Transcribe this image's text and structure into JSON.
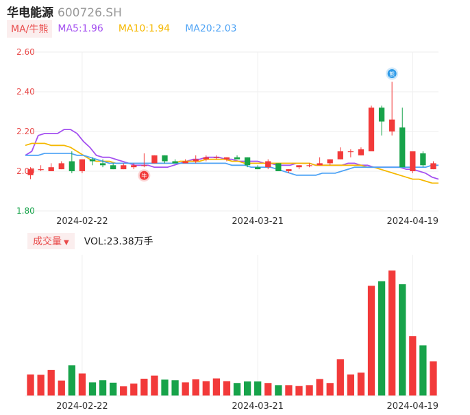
{
  "header": {
    "name": "华电能源",
    "code": "600726.SH"
  },
  "legend": {
    "tag": "MA/牛熊",
    "items": [
      {
        "label": "MA5:1.96",
        "color": "#a450f0"
      },
      {
        "label": "MA10:1.94",
        "color": "#f5b800"
      },
      {
        "label": "MA20:2.03",
        "color": "#4ea3f5"
      }
    ]
  },
  "volume_legend": {
    "tag": "成交量",
    "caret": "▼",
    "value": "VOL:23.38万手"
  },
  "markers": {
    "bull_glyph": "牛",
    "bear_glyph": "熊"
  },
  "colors": {
    "up": "#f23a3a",
    "down": "#17a34a",
    "axis_label": "#e94b4b",
    "grid": "#eeeeee"
  },
  "chart_data": [
    {
      "type": "candlestick",
      "y_ticks": [
        "2.60",
        "2.40",
        "2.20",
        "2.00",
        "1.80"
      ],
      "ylim": [
        1.8,
        2.6
      ],
      "x_labels": [
        {
          "index": 5,
          "label": "2024-02-22"
        },
        {
          "index": 22,
          "label": "2024-03-21"
        },
        {
          "index": 37,
          "label": "2024-04-19"
        }
      ],
      "candles": [
        {
          "o": 1.98,
          "h": 2.02,
          "l": 1.96,
          "c": 2.01
        },
        {
          "o": 2.01,
          "h": 2.03,
          "l": 2.0,
          "c": 2.01
        },
        {
          "o": 2.0,
          "h": 2.04,
          "l": 2.0,
          "c": 2.02
        },
        {
          "o": 2.01,
          "h": 2.05,
          "l": 2.01,
          "c": 2.04
        },
        {
          "o": 2.05,
          "h": 2.1,
          "l": 1.99,
          "c": 2.0
        },
        {
          "o": 2.0,
          "h": 2.06,
          "l": 1.99,
          "c": 2.06
        },
        {
          "o": 2.06,
          "h": 2.07,
          "l": 2.03,
          "c": 2.05
        },
        {
          "o": 2.04,
          "h": 2.06,
          "l": 2.02,
          "c": 2.03
        },
        {
          "o": 2.03,
          "h": 2.04,
          "l": 2.01,
          "c": 2.01
        },
        {
          "o": 2.01,
          "h": 2.04,
          "l": 2.01,
          "c": 2.03
        },
        {
          "o": 2.02,
          "h": 2.04,
          "l": 2.01,
          "c": 2.03
        },
        {
          "o": 2.03,
          "h": 2.09,
          "l": 2.02,
          "c": 2.03
        },
        {
          "o": 2.04,
          "h": 2.08,
          "l": 2.04,
          "c": 2.08
        },
        {
          "o": 2.08,
          "h": 2.08,
          "l": 2.04,
          "c": 2.05
        },
        {
          "o": 2.05,
          "h": 2.06,
          "l": 2.04,
          "c": 2.04
        },
        {
          "o": 2.04,
          "h": 2.06,
          "l": 2.04,
          "c": 2.05
        },
        {
          "o": 2.05,
          "h": 2.08,
          "l": 2.04,
          "c": 2.06
        },
        {
          "o": 2.06,
          "h": 2.08,
          "l": 2.05,
          "c": 2.07
        },
        {
          "o": 2.07,
          "h": 2.08,
          "l": 2.06,
          "c": 2.07
        },
        {
          "o": 2.06,
          "h": 2.07,
          "l": 2.05,
          "c": 2.07
        },
        {
          "o": 2.07,
          "h": 2.08,
          "l": 2.06,
          "c": 2.06
        },
        {
          "o": 2.07,
          "h": 2.07,
          "l": 2.02,
          "c": 2.03
        },
        {
          "o": 2.02,
          "h": 2.03,
          "l": 2.01,
          "c": 2.01
        },
        {
          "o": 2.02,
          "h": 2.06,
          "l": 2.01,
          "c": 2.05
        },
        {
          "o": 2.04,
          "h": 2.04,
          "l": 2.0,
          "c": 2.0
        },
        {
          "o": 2.0,
          "h": 2.01,
          "l": 1.99,
          "c": 2.01
        },
        {
          "o": 2.02,
          "h": 2.03,
          "l": 2.01,
          "c": 2.03
        },
        {
          "o": 2.03,
          "h": 2.04,
          "l": 2.02,
          "c": 2.03
        },
        {
          "o": 2.03,
          "h": 2.07,
          "l": 2.03,
          "c": 2.04
        },
        {
          "o": 2.04,
          "h": 2.06,
          "l": 2.03,
          "c": 2.06
        },
        {
          "o": 2.06,
          "h": 2.12,
          "l": 2.06,
          "c": 2.1
        },
        {
          "o": 2.1,
          "h": 2.11,
          "l": 2.07,
          "c": 2.1
        },
        {
          "o": 2.08,
          "h": 2.12,
          "l": 2.08,
          "c": 2.11
        },
        {
          "o": 2.1,
          "h": 2.33,
          "l": 2.1,
          "c": 2.32
        },
        {
          "o": 2.32,
          "h": 2.33,
          "l": 2.18,
          "c": 2.25
        },
        {
          "o": 2.2,
          "h": 2.45,
          "l": 2.18,
          "c": 2.26
        },
        {
          "o": 2.22,
          "h": 2.32,
          "l": 2.02,
          "c": 2.02
        },
        {
          "o": 2.0,
          "h": 2.1,
          "l": 1.99,
          "c": 2.1
        },
        {
          "o": 2.09,
          "h": 2.1,
          "l": 2.02,
          "c": 2.03
        },
        {
          "o": 2.01,
          "h": 2.05,
          "l": 2.01,
          "c": 2.04
        }
      ],
      "ma5": [
        2.08,
        2.1,
        2.18,
        2.19,
        2.19,
        2.19,
        2.21,
        2.21,
        2.19,
        2.15,
        2.12,
        2.08,
        2.07,
        2.07,
        2.06,
        2.05,
        2.04,
        2.03,
        2.03,
        2.03,
        2.02,
        2.02,
        2.02,
        2.03,
        2.04,
        2.05,
        2.06,
        2.06,
        2.07,
        2.07,
        2.07,
        2.06,
        2.06,
        2.05,
        2.05,
        2.05,
        2.05,
        2.04,
        2.04,
        2.03,
        2.03,
        2.03,
        2.04,
        2.04,
        2.04,
        2.03,
        2.03,
        2.03,
        2.03,
        2.03,
        2.04,
        2.04,
        2.03,
        2.03,
        2.02,
        2.02,
        2.02,
        2.02,
        2.02,
        2.01,
        2.01,
        2.0,
        1.99,
        1.97,
        1.96
      ],
      "ma10": [
        2.13,
        2.14,
        2.14,
        2.14,
        2.13,
        2.13,
        2.13,
        2.12,
        2.1,
        2.08,
        2.06,
        2.05,
        2.05,
        2.05,
        2.04,
        2.04,
        2.04,
        2.04,
        2.04,
        2.04,
        2.04,
        2.04,
        2.04,
        2.04,
        2.05,
        2.05,
        2.05,
        2.05,
        2.06,
        2.06,
        2.06,
        2.06,
        2.05,
        2.05,
        2.04,
        2.04,
        2.04,
        2.04,
        2.04,
        2.04,
        2.04,
        2.04,
        2.04,
        2.04,
        2.04,
        2.03,
        2.03,
        2.03,
        2.03,
        2.03,
        2.03,
        2.03,
        2.03,
        2.02,
        2.02,
        2.01,
        2.0,
        1.99,
        1.98,
        1.97,
        1.96,
        1.96,
        1.95,
        1.94,
        1.94
      ],
      "ma20": [
        2.08,
        2.08,
        2.08,
        2.09,
        2.09,
        2.09,
        2.09,
        2.09,
        2.08,
        2.08,
        2.07,
        2.06,
        2.05,
        2.04,
        2.04,
        2.04,
        2.04,
        2.04,
        2.04,
        2.04,
        2.04,
        2.04,
        2.04,
        2.04,
        2.04,
        2.04,
        2.04,
        2.04,
        2.04,
        2.04,
        2.04,
        2.04,
        2.03,
        2.03,
        2.03,
        2.02,
        2.02,
        2.02,
        2.02,
        2.01,
        2.0,
        1.99,
        1.98,
        1.98,
        1.98,
        1.98,
        1.99,
        1.99,
        1.99,
        2.0,
        2.01,
        2.02,
        2.02,
        2.02,
        2.02,
        2.02,
        2.02,
        2.02,
        2.02,
        2.02,
        2.02,
        2.02,
        2.02,
        2.03,
        2.03
      ],
      "markers": [
        {
          "index": 11,
          "kind": "bull"
        },
        {
          "index": 35,
          "kind": "bear"
        }
      ]
    },
    {
      "type": "bar",
      "name": "VOL",
      "values": [
        7.0,
        6.9,
        8.5,
        5.0,
        10.0,
        7.3,
        4.4,
        5.1,
        4.3,
        3.1,
        4.0,
        5.6,
        6.6,
        5.3,
        5.1,
        4.4,
        5.4,
        4.8,
        5.7,
        4.8,
        4.2,
        4.7,
        4.7,
        4.2,
        3.5,
        3.5,
        3.2,
        3.5,
        5.5,
        4.2,
        12.0,
        7.0,
        7.6,
        36.0,
        37.5,
        41.0,
        36.5,
        19.5,
        16.5,
        11.3
      ]
    }
  ]
}
